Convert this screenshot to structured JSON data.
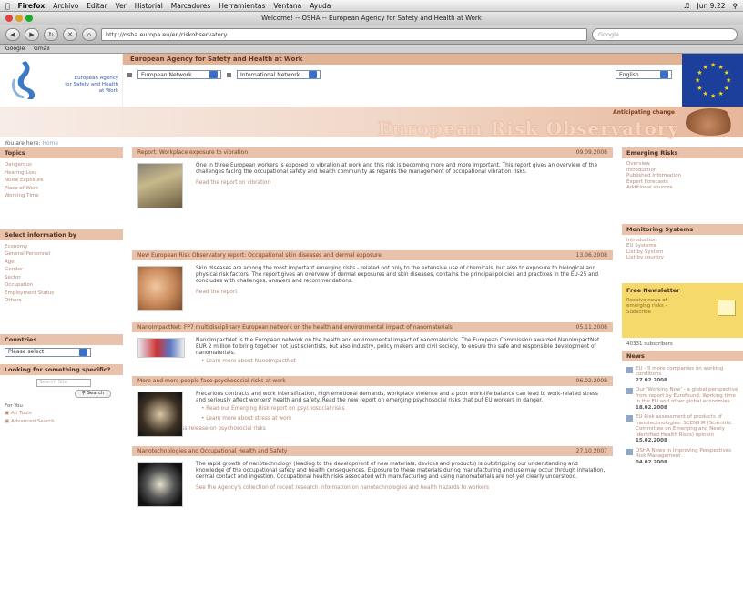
{
  "mac_menu": {
    "app": "Firefox",
    "items": [
      "Archivo",
      "Editar",
      "Ver",
      "Historial",
      "Marcadores",
      "Herramientas",
      "Ventana",
      "Ayuda"
    ],
    "clock": "Jun 9:22"
  },
  "window": {
    "title": "Welcome! -- OSHA -- European Agency for Safety and Health at Work"
  },
  "browser": {
    "url": "http://osha.europa.eu/en/riskobservatory",
    "search_placeholder": "Google"
  },
  "bookmarks": [
    "Google",
    "Gmail"
  ],
  "header": {
    "agency": "European Agency for Safety and Health at Work",
    "logo_text": [
      "European Agency",
      "for Safety and Health",
      "at Work"
    ],
    "select1": "European Network",
    "select2": "International Network",
    "language": "English"
  },
  "banner": {
    "tagline": "Anticipating change",
    "title": "European Risk Observatory"
  },
  "breadcrumb": {
    "label": "You are here:",
    "current": "Home"
  },
  "left": {
    "topics_title": "Topics",
    "topics": [
      "Dangerous",
      "Hearing Loss",
      "Noise Exposure",
      "Place of Work",
      "Working Time"
    ],
    "select_title": "Select information by",
    "select_items": [
      "Economy",
      "General Personnel",
      "Age",
      "Gender",
      "Sector",
      "Occupation",
      "Employment Status",
      "Others"
    ],
    "countries_title": "Countries",
    "country_select": "Please select",
    "looking_title": "Looking for something specific?",
    "search_placeholder": "Search Site",
    "search_button": "Search",
    "for_you": "For You",
    "links": [
      "Alt Tools",
      "Advanced Search"
    ]
  },
  "articles": [
    {
      "title": "Report: Workplace exposure to vibration",
      "date": "09.09.2008",
      "body": "One in three European workers is exposed to vibration at work and this risk is becoming more and more important. This report gives an overview of the challenges facing the occupational safety and health community as regards the management of occupational vibration risks.",
      "more": "Read the report on vibration",
      "bullets": []
    },
    {
      "title": "New European Risk Observatory report: Occupational skin diseases and dermal exposure",
      "date": "13.06.2008",
      "body": "Skin diseases are among the most important emerging risks - related not only to the extensive use of chemicals, but also to exposure to biological and physical risk factors. The report gives an overview of dermal exposures and skin diseases, contains the principal policies and practices in the EU-25 and concludes with challenges, answers and recommendations.",
      "more": "Read the report",
      "bullets": []
    },
    {
      "title": "NanoImpactNet: FP7 multidisciplinary European network on the health and environmental impact of nanomaterials",
      "date": "05.11.2008",
      "body": "NanoImpactNet is the European network on the health and environmental impact of nanomaterials. The European Commission awarded NanoImpactNet EUR 2 million to bring together not just scientists, but also industry, policy makers and civil society, to ensure the safe and responsible development of nanomaterials.",
      "more": "",
      "bullets": [
        "Learn more about NanoImpactNet"
      ]
    },
    {
      "title": "More and more people face psychosocial risks at work",
      "date": "06.02.2008",
      "body": "Precarious contracts and work intensification, high emotional demands, workplace violence and a poor work-life balance can lead to work-related stress and seriously affect workers' health and safety. Read the new report on emerging psychosocial risks that put EU workers in danger.",
      "more": "",
      "bullets": [
        "Read our Emerging Risk report on psychosocial risks",
        "Learn more about stress at work",
        "Read the press release on psychosocial risks"
      ]
    },
    {
      "title": "Nanotechnologies and Occupational Health and Safety",
      "date": "27.10.2007",
      "body": "The rapid growth of nanotechnology (leading to the development of new materials, devices and products) is outstripping our understanding and knowledge of the occupational safety and health consequences. Exposure to these materials during manufacturing and use may occur through inhalation, dermal contact and ingestion. Occupational health risks associated with manufacturing and using nanomaterials are not yet clearly understood.",
      "more": "See the Agency's collection of recent research information on nanotechnologies and health hazards to workers",
      "bullets": []
    }
  ],
  "right": {
    "emerging_title": "Emerging Risks",
    "emerging": [
      "Overview",
      "Introduction",
      "Published Information",
      "Expert Forecasts",
      "Additional sources"
    ],
    "monitoring_title": "Monitoring Systems",
    "monitoring": [
      "Introduction",
      "EU Systems",
      "List by System",
      "List by country"
    ],
    "newsletter_title": "Free Newsletter",
    "newsletter_text": "Receive news of emerging risks - Subscribe",
    "subscribers": "40331 subscribers",
    "news_title": "News",
    "news": [
      {
        "text": "EU - 5 more companies on working conditions",
        "date": "27.02.2008"
      },
      {
        "text": "Our 'Working Now' - a global perspective from report by Eurofound, Working time in the EU and other global economies",
        "date": "18.02.2008"
      },
      {
        "text": "EU Risk assessment of products of nanotechnologies: SCENIHR (Scientific Committee on Emerging and Newly Identified Health Risks) opinion",
        "date": "15.02.2008"
      },
      {
        "text": "OSHA News in Improving Perspectives Risk Management",
        "date": "04.02.2008"
      }
    ]
  }
}
